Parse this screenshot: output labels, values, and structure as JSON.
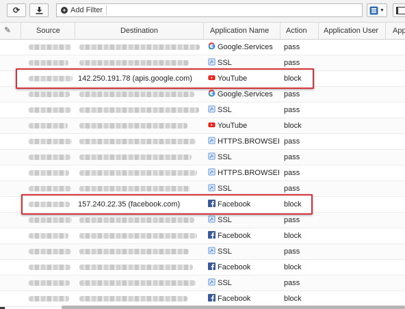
{
  "toolbar": {
    "refresh_icon": "refresh-icon",
    "download_icon": "download-icon",
    "add_filter_label": "Add Filter"
  },
  "columns": [
    {
      "label": "Source"
    },
    {
      "label": "Destination"
    },
    {
      "label": "Application Name"
    },
    {
      "label": "Action"
    },
    {
      "label": "Application User"
    },
    {
      "label": "App"
    }
  ],
  "rows": [
    {
      "destination": "",
      "app": "Google.Services",
      "icon": "google",
      "action": "pass",
      "highlight": false
    },
    {
      "destination": "",
      "app": "SSL",
      "icon": "ssl",
      "action": "pass",
      "highlight": false
    },
    {
      "destination": "142.250.191.78 (apis.google.com)",
      "app": "YouTube",
      "icon": "youtube",
      "action": "block",
      "highlight": true
    },
    {
      "destination": "",
      "app": "Google.Services",
      "icon": "google",
      "action": "pass",
      "highlight": false
    },
    {
      "destination": "",
      "app": "SSL",
      "icon": "ssl",
      "action": "pass",
      "highlight": false
    },
    {
      "destination": "",
      "app": "YouTube",
      "icon": "youtube",
      "action": "block",
      "highlight": false
    },
    {
      "destination": "",
      "app": "HTTPS.BROWSER",
      "icon": "ssl",
      "action": "pass",
      "highlight": false
    },
    {
      "destination": "",
      "app": "SSL",
      "icon": "ssl",
      "action": "pass",
      "highlight": false
    },
    {
      "destination": "",
      "app": "HTTPS.BROWSER",
      "icon": "ssl",
      "action": "pass",
      "highlight": false
    },
    {
      "destination": "",
      "app": "SSL",
      "icon": "ssl",
      "action": "pass",
      "highlight": false
    },
    {
      "destination": "157.240.22.35 (facebook.com)",
      "app": "Facebook",
      "icon": "facebook",
      "action": "block",
      "highlight": true
    },
    {
      "destination": "",
      "app": "SSL",
      "icon": "ssl",
      "action": "pass",
      "highlight": false
    },
    {
      "destination": "",
      "app": "Facebook",
      "icon": "facebook",
      "action": "block",
      "highlight": false
    },
    {
      "destination": "",
      "app": "SSL",
      "icon": "ssl",
      "action": "pass",
      "highlight": false
    },
    {
      "destination": "",
      "app": "Facebook",
      "icon": "facebook",
      "action": "block",
      "highlight": false
    },
    {
      "destination": "",
      "app": "SSL",
      "icon": "ssl",
      "action": "pass",
      "highlight": false
    },
    {
      "destination": "",
      "app": "Facebook",
      "icon": "facebook",
      "action": "block",
      "highlight": false
    }
  ],
  "colors": {
    "highlight": "#d8323a",
    "youtube": "#e62117",
    "facebook": "#3b5998",
    "ssl": "#5b8fd6"
  }
}
